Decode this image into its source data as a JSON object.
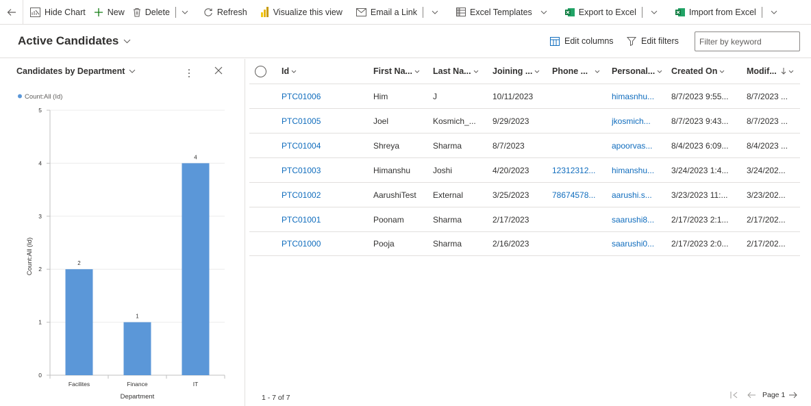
{
  "toolbar": {
    "hide_chart": "Hide Chart",
    "new": "New",
    "delete": "Delete",
    "refresh": "Refresh",
    "visualize": "Visualize this view",
    "email_link": "Email a Link",
    "excel_templates": "Excel Templates",
    "export_excel": "Export to Excel",
    "import_excel": "Import from Excel"
  },
  "view": {
    "title": "Active Candidates",
    "edit_columns": "Edit columns",
    "edit_filters": "Edit filters",
    "filter_placeholder": "Filter by keyword"
  },
  "chart_pane": {
    "title": "Candidates by Department"
  },
  "chart_data": {
    "type": "bar",
    "categories": [
      "Facilites",
      "Finance",
      "IT"
    ],
    "series": [
      {
        "name": "Count:All (Id)",
        "values": [
          2,
          1,
          4
        ]
      }
    ],
    "data_labels": [
      "2",
      "1",
      "4"
    ],
    "xlabel": "Department",
    "ylabel": "Count:All (Id)",
    "ylim": [
      0,
      5
    ],
    "yticks": [
      "0",
      "1",
      "2",
      "3",
      "4",
      "5"
    ],
    "legend_label": "Count:All (Id)",
    "legend_position": "top-left",
    "grid": true,
    "color": "#5b97d8"
  },
  "grid": {
    "columns": [
      "Id",
      "First Na...",
      "Last Na...",
      "Joining ...",
      "Phone ...",
      "Personal...",
      "Created On",
      "Modif..."
    ],
    "rows": [
      {
        "id": "PTC01006",
        "first": "Him",
        "last": "J",
        "joining": "10/11/2023",
        "phone": "",
        "personal": "himasnhu...",
        "created": "8/7/2023 9:55...",
        "modified": "8/7/2023 ..."
      },
      {
        "id": "PTC01005",
        "first": "Joel",
        "last": "Kosmich_...",
        "joining": "9/29/2023",
        "phone": "",
        "personal": "jkosmich...",
        "created": "8/7/2023 9:43...",
        "modified": "8/7/2023 ..."
      },
      {
        "id": "PTC01004",
        "first": "Shreya",
        "last": "Sharma",
        "joining": "8/7/2023",
        "phone": "",
        "personal": "apoorvas...",
        "created": "8/4/2023 6:09...",
        "modified": "8/4/2023 ..."
      },
      {
        "id": "PTC01003",
        "first": "Himanshu",
        "last": "Joshi",
        "joining": "4/20/2023",
        "phone": "12312312...",
        "personal": "himanshu...",
        "created": "3/24/2023 1:4...",
        "modified": "3/24/202..."
      },
      {
        "id": "PTC01002",
        "first": "AarushiTest",
        "last": "External",
        "joining": "3/25/2023",
        "phone": "78674578...",
        "personal": "aarushi.s...",
        "created": "3/23/2023 11:...",
        "modified": "3/23/202..."
      },
      {
        "id": "PTC01001",
        "first": "Poonam",
        "last": "Sharma",
        "joining": "2/17/2023",
        "phone": "",
        "personal": "saarushi8...",
        "created": "2/17/2023 2:1...",
        "modified": "2/17/202..."
      },
      {
        "id": "PTC01000",
        "first": "Pooja",
        "last": "Sharma",
        "joining": "2/16/2023",
        "phone": "",
        "personal": "saarushi0...",
        "created": "2/17/2023 2:0...",
        "modified": "2/17/202..."
      }
    ],
    "record_count": "1 - 7 of 7",
    "page_label": "Page 1"
  }
}
